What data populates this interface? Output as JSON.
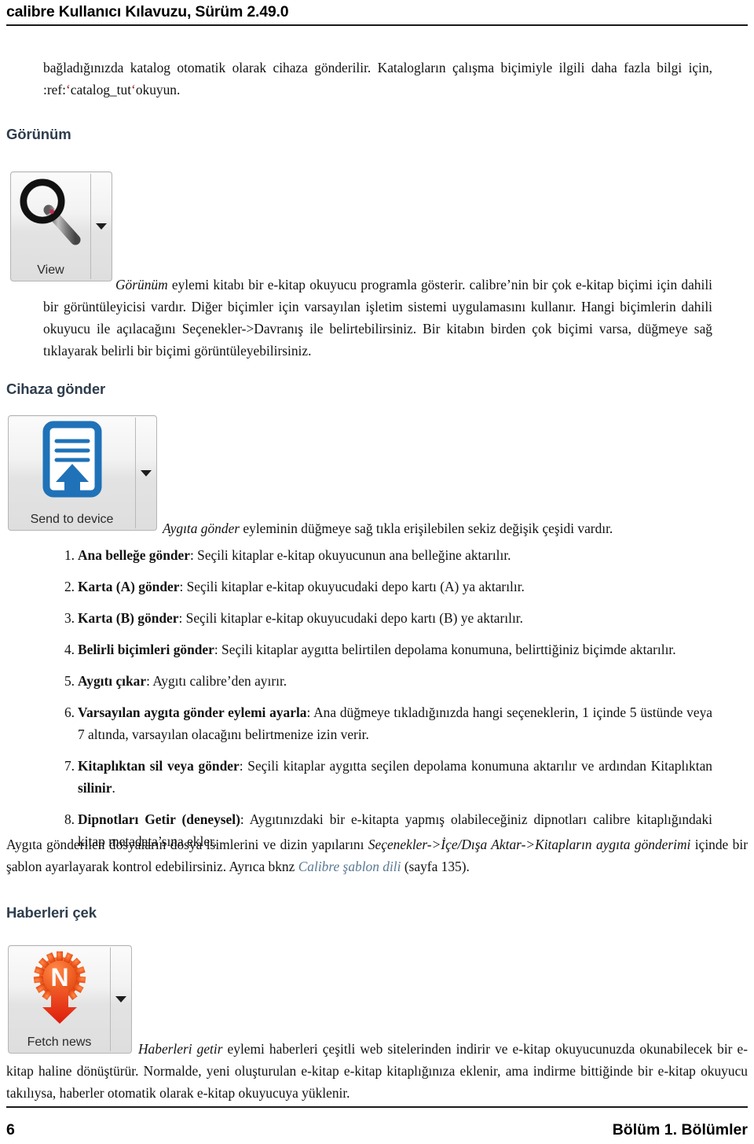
{
  "header": {
    "title": "calibre Kullanıcı Kılavuzu, Sürüm 2.49.0"
  },
  "intro": {
    "line1": "bağladığınızda katalog otomatik olarak cihaza gönderilir. Katalogların çalışma biçimiyle ilgili daha fazla bilgi için, :ref:",
    "quote_open": "‘",
    "code": "catalog_tut",
    "quote_close": "‘",
    "line_end": "okuyun."
  },
  "sections": [
    {
      "heading": "Görünüm",
      "button": {
        "label": "View",
        "icon": "magnifier-icon",
        "has_dropdown": true
      },
      "paragraph_italic": "Görünüm",
      "paragraph": " eylemi kitabı bir e-kitap okuyucu programla gösterir. calibre’nin bir çok e-kitap biçimi için dahili bir görüntüleyicisi vardır. Diğer biçimler için varsayılan işletim sistemi uygulamasını kullanır. Hangi biçimlerin dahili okuyucu ile açılacağını Seçenekler->Davranış ile belirtebilirsiniz. Bir kitabın birden çok biçimi varsa, düğmeye sağ tıklayarak belirli bir biçimi görüntüleyebilirsiniz."
    },
    {
      "heading": "Cihaza gönder",
      "button": {
        "label": "Send to device",
        "icon": "document-upload-icon",
        "has_dropdown": true
      },
      "paragraph_italic": "Aygıta gönder",
      "paragraph": " eyleminin düğmeye sağ tıkla erişilebilen sekiz değişik çeşidi vardır."
    },
    {
      "heading": "Haberleri çek",
      "button": {
        "label": "Fetch news",
        "icon": "news-download-icon",
        "has_dropdown": true
      },
      "paragraph_italic": "Haberleri getir",
      "paragraph": " eylemi haberleri çeşitli web sitelerinden indirir ve e-kitap okuyucunuzda okunabilecek bir e-kitap haline dönüştürür. Normalde, yeni oluşturulan e-kitap e-kitap kitaplığınıza eklenir, ama indirme bittiğinde bir e-kitap okuyucu takılıysa, haberler otomatik olarak e-kitap okuyucuya yüklenir."
    }
  ],
  "send_list": [
    {
      "term": "Ana belleğe gönder",
      "desc": ": Seçili kitaplar e-kitap okuyucunun ana belleğine aktarılır."
    },
    {
      "term": "Karta (A) gönder",
      "desc": ": Seçili kitaplar e-kitap okuyucudaki depo kartı (A) ya aktarılır."
    },
    {
      "term": "Karta (B) gönder",
      "desc": ": Seçili kitaplar e-kitap okuyucudaki depo kartı (B) ye aktarılır."
    },
    {
      "term": "Belirli biçimleri gönder",
      "desc": ": Seçili kitaplar aygıtta belirtilen depolama konumuna, belirttiğiniz biçimde aktarılır."
    },
    {
      "term": "Aygıtı çıkar",
      "desc": ": Aygıtı calibre’den ayırır."
    },
    {
      "term": "Varsayılan aygıta gönder eylemi ayarla",
      "desc": ": Ana düğmeye tıkladığınızda hangi seçeneklerin, 1 içinde 5 üstünde veya 7 altında, varsayılan olacağını belirtmenize izin verir."
    },
    {
      "term": "Kitaplıktan sil veya gönder",
      "desc_a": ": Seçili kitaplar aygıtta seçilen depolama konumuna aktarılır ve ardından Kitaplıktan ",
      "desc_bold": "silinir",
      "desc_b": "."
    },
    {
      "term": "Dipnotları Getir (deneysel)",
      "desc": ": Aygıtınızdaki bir e-kitapta yapmış olabileceğiniz dipnotları calibre kitaplığındaki kitap metadata’sına ekler."
    }
  ],
  "template_paragraph": {
    "part1": "Aygıta gönderilen dosyaların dosya isimlerini ve dizin yapılarını ",
    "italic1": "Seçenekler->İçe/Dışa Aktar->Kitapların aygıta gönderimi",
    "part2": " içinde bir şablon ayarlayarak kontrol edebilirsiniz. Ayrıca bknz ",
    "link": "Calibre şablon dili",
    "part3": " (sayfa 135)."
  },
  "footer": {
    "page_number": "6",
    "chapter": "Bölüm 1.  Bölümler"
  },
  "colors": {
    "heading": "#2e3d4d",
    "link": "#5a7a94",
    "code_quote": "#a01a1a",
    "send_icon_blue": "#1f72b8",
    "news_icon_orange": "#ee5b22",
    "news_arrow_red": "#e02a12"
  }
}
